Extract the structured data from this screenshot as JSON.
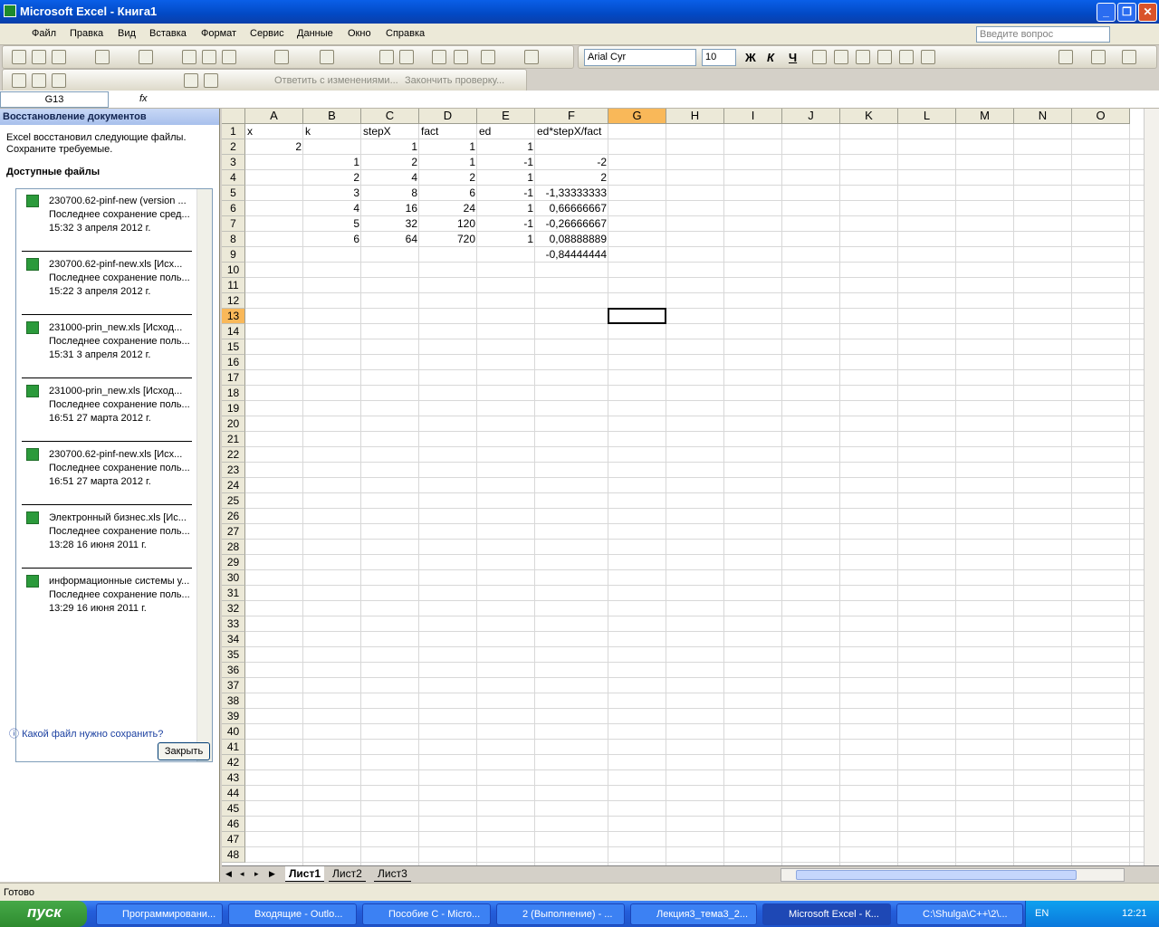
{
  "window": {
    "title": "Microsoft Excel - Книга1"
  },
  "menu": [
    "Файл",
    "Правка",
    "Вид",
    "Вставка",
    "Формат",
    "Сервис",
    "Данные",
    "Окно",
    "Справка"
  ],
  "ask_placeholder": "Введите вопрос",
  "format": {
    "font": "Arial Cyr",
    "size": "10",
    "bold": "Ж",
    "italic": "К",
    "underline": "Ч"
  },
  "review": {
    "reply": "Ответить с изменениями...",
    "end": "Закончить проверку..."
  },
  "namebox": "G13",
  "fx": "fx",
  "pane": {
    "title": "Восстановление документов",
    "message": "Excel восстановил следующие файлы. Сохраните требуемые.",
    "available": "Доступные файлы",
    "files": [
      {
        "name": "230700.62-pinf-new (version ...",
        "status": "Последнее сохранение сред...",
        "date": "15:32 3 апреля 2012 г."
      },
      {
        "name": "230700.62-pinf-new.xls [Исх...",
        "status": "Последнее сохранение поль...",
        "date": "15:22 3 апреля 2012 г."
      },
      {
        "name": "231000-prin_new.xls [Исход...",
        "status": "Последнее сохранение поль...",
        "date": "15:31 3 апреля 2012 г."
      },
      {
        "name": "231000-prin_new.xls [Исход...",
        "status": "Последнее сохранение поль...",
        "date": "16:51 27 марта 2012 г."
      },
      {
        "name": "230700.62-pinf-new.xls [Исх...",
        "status": "Последнее сохранение поль...",
        "date": "16:51 27 марта 2012 г."
      },
      {
        "name": "Электронный бизнес.xls [Ис...",
        "status": "Последнее сохранение поль...",
        "date": "13:28 16 июня 2011 г."
      },
      {
        "name": "информационные системы у...",
        "status": "Последнее сохранение поль...",
        "date": "13:29 16 июня 2011 г."
      }
    ],
    "help": "Какой файл нужно сохранить?",
    "close": "Закрыть"
  },
  "columns": [
    "A",
    "B",
    "C",
    "D",
    "E",
    "F",
    "G",
    "H",
    "I",
    "J",
    "K",
    "L",
    "M",
    "N",
    "O"
  ],
  "cells": [
    [
      "x",
      "k",
      "stepX",
      "fact",
      "ed",
      "ed*stepX/fact"
    ],
    [
      "2",
      "",
      "1",
      "1",
      "1",
      ""
    ],
    [
      "",
      "1",
      "2",
      "1",
      "-1",
      "-2"
    ],
    [
      "",
      "2",
      "4",
      "2",
      "1",
      "2"
    ],
    [
      "",
      "3",
      "8",
      "6",
      "-1",
      "-1,33333333"
    ],
    [
      "",
      "4",
      "16",
      "24",
      "1",
      "0,66666667"
    ],
    [
      "",
      "5",
      "32",
      "120",
      "-1",
      "-0,26666667"
    ],
    [
      "",
      "6",
      "64",
      "720",
      "1",
      "0,08888889"
    ],
    [
      "",
      "",
      "",
      "",
      "",
      "-0,84444444"
    ]
  ],
  "sheets": [
    "Лист1",
    "Лист2",
    "Лист3"
  ],
  "status": "Готово",
  "taskbar": {
    "start": "пуск",
    "items": [
      "Программировани...",
      "Входящие - Outlo...",
      "Пособие С - Micro...",
      "2 (Выполнение) - ...",
      "Лекция3_тема3_2...",
      "Microsoft Excel - К...",
      "C:\\Shulga\\C++\\2\\..."
    ],
    "lang": "EN",
    "clock": "12:21"
  }
}
